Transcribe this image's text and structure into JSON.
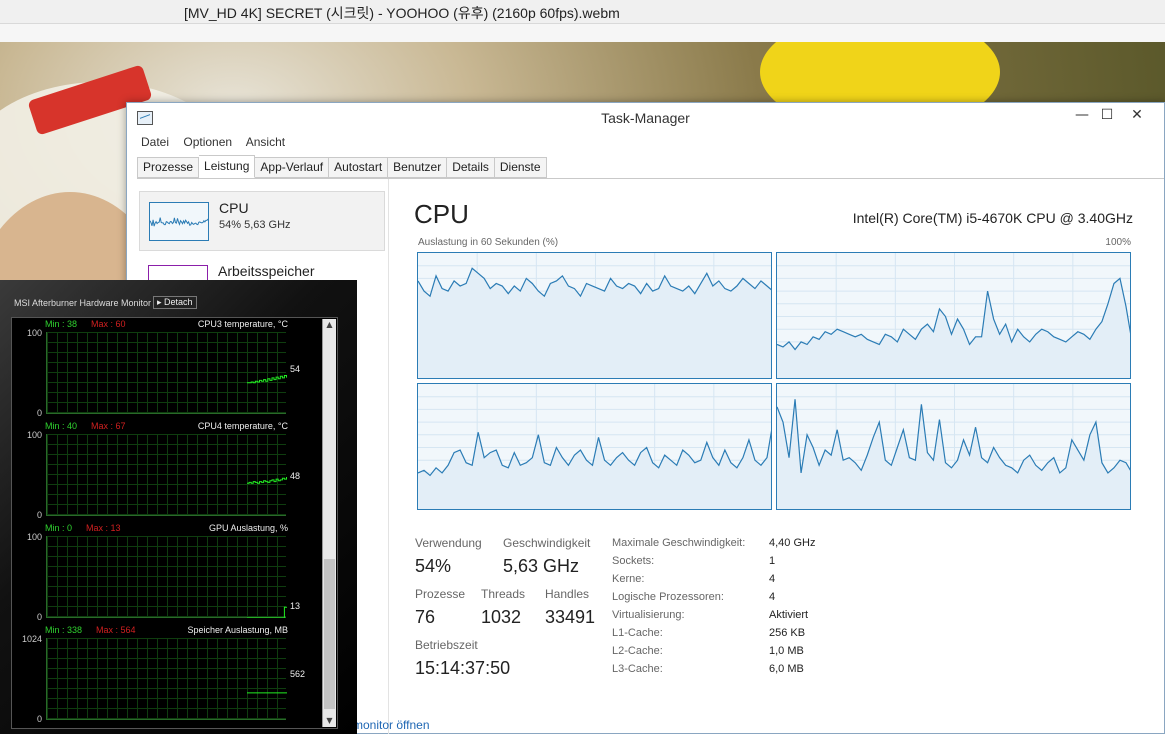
{
  "video": {
    "title": "[MV_HD 4K] SECRET (시크릿) - YOOHOO (유후) (2160p 60fps).webm"
  },
  "taskmanager": {
    "title": "Task-Manager",
    "window_buttons": {
      "minimize": "—",
      "maximize": "☐",
      "close": "✕"
    },
    "menu": [
      "Datei",
      "Optionen",
      "Ansicht"
    ],
    "tabs": [
      "Prozesse",
      "Leistung",
      "App-Verlauf",
      "Autostart",
      "Benutzer",
      "Details",
      "Dienste"
    ],
    "active_tab": "Leistung",
    "sidebar": [
      {
        "name": "CPU",
        "sub": "54%  5,63 GHz",
        "selected": true
      },
      {
        "name": "Arbeitsspeicher",
        "sub": "",
        "selected": false
      }
    ],
    "heading": "CPU",
    "model": "Intel(R) Core(TM) i5-4670K CPU @ 3.40GHz",
    "graph_caption": "Auslastung in 60 Sekunden (%)",
    "graph_max": "100%",
    "stats": {
      "usage_label": "Verwendung",
      "usage_value": "54%",
      "speed_label": "Geschwindigkeit",
      "speed_value": "5,63 GHz",
      "processes_label": "Prozesse",
      "processes_value": "76",
      "threads_label": "Threads",
      "threads_value": "1032",
      "handles_label": "Handles",
      "handles_value": "33491",
      "uptime_label": "Betriebszeit",
      "uptime_value": "15:14:37:50"
    },
    "specs": [
      {
        "label": "Maximale Geschwindigkeit:",
        "value": "4,40 GHz"
      },
      {
        "label": "Sockets:",
        "value": "1"
      },
      {
        "label": "Kerne:",
        "value": "4"
      },
      {
        "label": "Logische Prozessoren:",
        "value": "4"
      },
      {
        "label": "Virtualisierung:",
        "value": "Aktiviert"
      },
      {
        "label": "L1-Cache:",
        "value": "256 KB"
      },
      {
        "label": "L2-Cache:",
        "value": "1,0 MB"
      },
      {
        "label": "L3-Cache:",
        "value": "6,0 MB"
      }
    ],
    "open_monitor_link": "monitor öffnen",
    "core_graphs": [
      {
        "values": [
          78,
          70,
          66,
          82,
          72,
          70,
          78,
          74,
          76,
          88,
          84,
          80,
          72,
          76,
          74,
          68,
          74,
          70,
          80,
          76,
          70,
          66,
          76,
          78,
          82,
          74,
          72,
          66,
          76,
          74,
          72,
          70,
          80,
          74,
          72,
          76,
          74,
          68,
          76,
          70,
          72,
          82,
          74,
          72,
          70,
          74,
          68,
          76,
          84,
          74,
          78,
          72,
          70,
          74,
          80,
          76,
          72,
          78,
          74,
          70
        ]
      },
      {
        "values": [
          28,
          26,
          30,
          24,
          30,
          28,
          34,
          32,
          38,
          36,
          40,
          38,
          36,
          34,
          36,
          32,
          30,
          28,
          36,
          34,
          30,
          40,
          36,
          32,
          40,
          44,
          38,
          56,
          50,
          36,
          48,
          40,
          28,
          34,
          34,
          70,
          48,
          36,
          44,
          30,
          40,
          34,
          30,
          36,
          40,
          38,
          34,
          32,
          30,
          34,
          38,
          36,
          32,
          40,
          46,
          60,
          76,
          80,
          58,
          30
        ]
      },
      {
        "values": [
          30,
          32,
          28,
          34,
          30,
          36,
          46,
          48,
          38,
          36,
          62,
          42,
          46,
          48,
          36,
          34,
          46,
          36,
          38,
          42,
          60,
          38,
          36,
          50,
          42,
          36,
          44,
          48,
          40,
          36,
          58,
          40,
          36,
          42,
          46,
          40,
          36,
          46,
          50,
          38,
          34,
          44,
          40,
          36,
          48,
          44,
          38,
          40,
          54,
          42,
          36,
          48,
          38,
          34,
          42,
          56,
          40,
          36,
          42,
          70
        ]
      },
      {
        "values": [
          82,
          70,
          42,
          88,
          30,
          60,
          50,
          36,
          48,
          44,
          64,
          40,
          42,
          38,
          32,
          44,
          58,
          70,
          40,
          36,
          50,
          64,
          42,
          40,
          84,
          46,
          40,
          72,
          38,
          34,
          40,
          56,
          44,
          66,
          42,
          38,
          50,
          42,
          36,
          34,
          30,
          40,
          44,
          36,
          32,
          38,
          42,
          30,
          34,
          56,
          48,
          40,
          60,
          70,
          38,
          30,
          34,
          40,
          38,
          30
        ]
      }
    ]
  },
  "msi": {
    "title": "MSI Afterburner Hardware Monitor",
    "detach": "Detach",
    "graphs": [
      {
        "title": "CPU3 temperature, °C",
        "min": "Min : 38",
        "max": "Max : 60",
        "top": "100",
        "bottom": "0",
        "current": "54",
        "range": [
          0,
          100
        ],
        "values": [
          38,
          38,
          39,
          38,
          40,
          39,
          41,
          40,
          42,
          40,
          43,
          41,
          44,
          42,
          45,
          43,
          46,
          44,
          47,
          45,
          48,
          46,
          52,
          48,
          50,
          54
        ]
      },
      {
        "title": "CPU4 temperature, °C",
        "min": "Min : 40",
        "max": "Max : 67",
        "top": "100",
        "bottom": "0",
        "current": "48",
        "range": [
          0,
          100
        ],
        "values": [
          40,
          41,
          40,
          42,
          41,
          40,
          42,
          41,
          43,
          42,
          41,
          43,
          44,
          42,
          45,
          43,
          44,
          46,
          45,
          47,
          46,
          50,
          47,
          49,
          48,
          48
        ]
      },
      {
        "title": "GPU Auslastung, %",
        "min": "Min : 0",
        "max": "Max : 13",
        "top": "100",
        "bottom": "0",
        "current": "13",
        "range": [
          0,
          100
        ],
        "values": [
          0,
          0,
          0,
          0,
          0,
          0,
          0,
          0,
          0,
          0,
          0,
          0,
          0,
          0,
          0,
          0,
          0,
          0,
          13,
          13,
          13,
          13,
          13,
          13,
          13,
          13
        ]
      },
      {
        "title": "Speicher Auslastung, MB",
        "min": "Min : 338",
        "max": "Max : 564",
        "top": "1024",
        "bottom": "0",
        "current": "562",
        "range": [
          0,
          1024
        ],
        "values": [
          338,
          338,
          338,
          338,
          338,
          338,
          338,
          338,
          338,
          338,
          338,
          338,
          338,
          338,
          338,
          338,
          338,
          338,
          338,
          338,
          562,
          562,
          562,
          562,
          562,
          562
        ]
      }
    ]
  }
}
